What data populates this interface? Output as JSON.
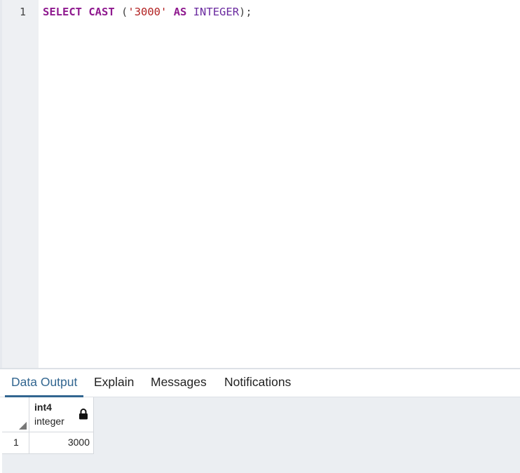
{
  "editor": {
    "line_number": "1",
    "tokens": {
      "select": "SELECT",
      "cast": "CAST",
      "open_paren": "(",
      "literal": "'3000'",
      "as": "AS",
      "type": "INTEGER",
      "close": ");"
    }
  },
  "tabs": [
    {
      "label": "Data Output",
      "active": true
    },
    {
      "label": "Explain",
      "active": false
    },
    {
      "label": "Messages",
      "active": false
    },
    {
      "label": "Notifications",
      "active": false
    }
  ],
  "grid": {
    "columns": [
      {
        "name": "int4",
        "type": "integer",
        "icon": "lock-icon"
      }
    ],
    "rows": [
      {
        "row_number": "1",
        "values": [
          "3000"
        ]
      }
    ]
  },
  "colors": {
    "keyword": "#8f1a8f",
    "string": "#b22222",
    "type": "#6a2a9f",
    "active_tab": "#326690",
    "gutter": "#eef0f3",
    "grid_background": "#ebeef2"
  }
}
